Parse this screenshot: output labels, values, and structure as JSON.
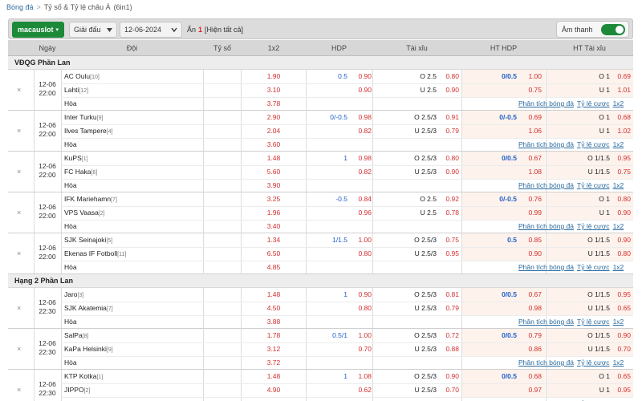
{
  "breadcrumb": {
    "root": "Bóng đá",
    "sep": ">",
    "current": "Tỷ số & Tỷ lệ châu Á",
    "extra": "(6in1)"
  },
  "toolbar": {
    "brand": "macauslot",
    "brand_caret": "▾",
    "league_label": "Giải đấu",
    "date_value": "12-06-2024",
    "hide_label": "Ẩn",
    "hide_count": "1",
    "show_all": "[Hiện tất cả]",
    "sound_label": "Âm thanh"
  },
  "columns": [
    "Ngày",
    "Đội",
    "Tỷ số",
    "1x2",
    "HDP",
    "Tài xỉu",
    "HT HDP",
    "HT Tài xỉu"
  ],
  "draw_label": "Hòa",
  "link1": "Phân tích bóng đá",
  "link2": "Tỷ lệ cược",
  "link3": "1x2",
  "leagues": [
    {
      "name": "VĐQG Phần Lan",
      "matches": [
        {
          "date": "12-06",
          "time": "22:00",
          "home": "AC Oulu",
          "home_rank": "[10]",
          "away": "Lahti",
          "away_rank": "[12]",
          "x12": [
            "1.90",
            "3.10",
            "3.78"
          ],
          "hdp_line": "0.5",
          "hdp": [
            "0.90",
            "0.90"
          ],
          "ou_home": "O 2.5",
          "ou_away": "U 2.5",
          "ou": [
            "0.80",
            "0.90"
          ],
          "hthdp_line": "0/0.5",
          "hthdp": [
            "1.00",
            "0.75"
          ],
          "htou_home": "O 1",
          "htou_away": "U 1",
          "htou": [
            "0.69",
            "1.01"
          ]
        },
        {
          "date": "12-06",
          "time": "22:00",
          "home": "Inter Turku",
          "home_rank": "[9]",
          "away": "Ilves Tampere",
          "away_rank": "[4]",
          "x12": [
            "2.90",
            "2.04",
            "3.60"
          ],
          "hdp_line": "0/-0.5",
          "hdp": [
            "0.98",
            "0.82"
          ],
          "ou_home": "O 2.5/3",
          "ou_away": "U 2.5/3",
          "ou": [
            "0.91",
            "0.79"
          ],
          "hthdp_line": "0/-0.5",
          "hthdp": [
            "0.69",
            "1.06"
          ],
          "htou_home": "O 1",
          "htou_away": "U 1",
          "htou": [
            "0.68",
            "1.02"
          ]
        },
        {
          "date": "12-06",
          "time": "22:00",
          "home": "KuPS",
          "home_rank": "[1]",
          "away": "FC Haka",
          "away_rank": "[6]",
          "x12": [
            "1.48",
            "5.60",
            "3.90"
          ],
          "hdp_line": "1",
          "hdp": [
            "0.98",
            "0.82"
          ],
          "ou_home": "O 2.5/3",
          "ou_away": "U 2.5/3",
          "ou": [
            "0.80",
            "0.90"
          ],
          "hthdp_line": "0/0.5",
          "hthdp": [
            "0.67",
            "1.08"
          ],
          "htou_home": "O 1/1.5",
          "htou_away": "U 1/1.5",
          "htou": [
            "0.95",
            "0.75"
          ]
        },
        {
          "date": "12-06",
          "time": "22:00",
          "home": "IFK Mariehamn",
          "home_rank": "[7]",
          "away": "VPS Vaasa",
          "away_rank": "[2]",
          "x12": [
            "3.25",
            "1.96",
            "3.40"
          ],
          "hdp_line": "-0.5",
          "hdp": [
            "0.84",
            "0.96"
          ],
          "ou_home": "O 2.5",
          "ou_away": "U 2.5",
          "ou": [
            "0.92",
            "0.78"
          ],
          "hthdp_line": "0/-0.5",
          "hthdp": [
            "0.76",
            "0.99"
          ],
          "htou_home": "O 1",
          "htou_away": "U 1",
          "htou": [
            "0.80",
            "0.90"
          ]
        },
        {
          "date": "12-06",
          "time": "22:00",
          "home": "SJK Seinajoki",
          "home_rank": "[5]",
          "away": "Ekenas IF Fotboll",
          "away_rank": "[11]",
          "x12": [
            "1.34",
            "6.50",
            "4.85"
          ],
          "hdp_line": "1/1.5",
          "hdp": [
            "1.00",
            "0.80"
          ],
          "ou_home": "O 2.5/3",
          "ou_away": "U 2.5/3",
          "ou": [
            "0.75",
            "0.95"
          ],
          "hthdp_line": "0.5",
          "hthdp": [
            "0.85",
            "0.90"
          ],
          "htou_home": "O 1/1.5",
          "htou_away": "U 1/1.5",
          "htou": [
            "0.90",
            "0.80"
          ]
        }
      ]
    },
    {
      "name": "Hạng 2 Phần Lan",
      "matches": [
        {
          "date": "12-06",
          "time": "22:30",
          "home": "Jaro",
          "home_rank": "[3]",
          "away": "SJK Akatemia",
          "away_rank": "[7]",
          "x12": [
            "1.48",
            "4.50",
            "3.88"
          ],
          "hdp_line": "1",
          "hdp": [
            "0.90",
            "0.80"
          ],
          "ou_home": "O 2.5/3",
          "ou_away": "U 2.5/3",
          "ou": [
            "0.81",
            "0.79"
          ],
          "hthdp_line": "0/0.5",
          "hthdp": [
            "0.67",
            "0.98"
          ],
          "htou_home": "O 1/1.5",
          "htou_away": "U 1/1.5",
          "htou": [
            "0.95",
            "0.65"
          ]
        },
        {
          "date": "12-06",
          "time": "22:30",
          "home": "SalPa",
          "home_rank": "[8]",
          "away": "KaPa Helsinki",
          "away_rank": "[9]",
          "x12": [
            "1.78",
            "3.12",
            "3.72"
          ],
          "hdp_line": "0.5/1",
          "hdp": [
            "1.00",
            "0.70"
          ],
          "ou_home": "O 2.5/3",
          "ou_away": "U 2.5/3",
          "ou": [
            "0.72",
            "0.88"
          ],
          "hthdp_line": "0/0.5",
          "hthdp": [
            "0.79",
            "0.86"
          ],
          "htou_home": "O 1/1.5",
          "htou_away": "U 1/1.5",
          "htou": [
            "0.90",
            "0.70"
          ]
        },
        {
          "date": "12-06",
          "time": "22:30",
          "home": "KTP Kotka",
          "home_rank": "[1]",
          "away": "JIPPO",
          "away_rank": "[2]",
          "x12": [
            "1.48",
            "4.90",
            ""
          ],
          "hdp_line": "1",
          "hdp": [
            "1.08",
            "0.62"
          ],
          "ou_home": "O 2.5/3",
          "ou_away": "U 2.5/3",
          "ou": [
            "0.90",
            "0.70"
          ],
          "hthdp_line": "0/0.5",
          "hthdp": [
            "0.68",
            "0.97"
          ],
          "htou_home": "O 1",
          "htou_away": "U 1",
          "htou": [
            "0.65",
            "0.95"
          ]
        }
      ]
    }
  ]
}
